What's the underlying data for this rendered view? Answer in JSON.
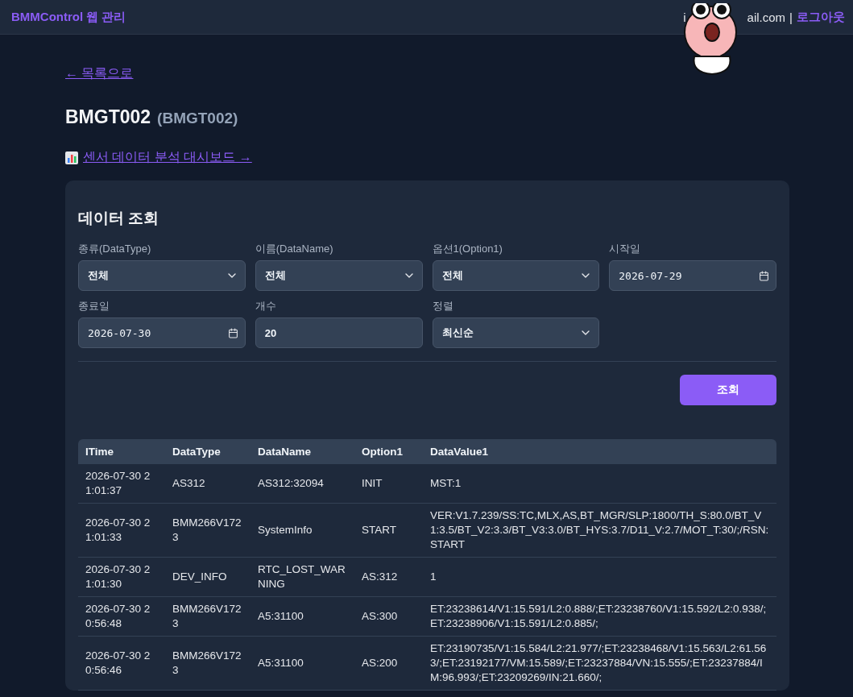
{
  "header": {
    "brand": "BMMControl 웹 관리",
    "email_start": "i",
    "email_end": "ail.com",
    "separator": "|",
    "logout": "로그아웃"
  },
  "back_link": "← 목록으로",
  "device": {
    "name": "BMGT002",
    "code": "(BMGT002)"
  },
  "dashboard_link": "센서 데이터 분석 대시보드 →",
  "query": {
    "title": "데이터 조회",
    "fields": [
      {
        "label": "종류(DataType)",
        "kind": "select",
        "value": "전체"
      },
      {
        "label": "이름(DataName)",
        "kind": "select",
        "value": "전체"
      },
      {
        "label": "옵션1(Option1)",
        "kind": "select",
        "value": "전체"
      },
      {
        "label": "시작일",
        "kind": "date",
        "value": "2026-07-29"
      },
      {
        "label": "종료일",
        "kind": "date",
        "value": "2026-07-30"
      },
      {
        "label": "개수",
        "kind": "number",
        "value": "20"
      },
      {
        "label": "정렬",
        "kind": "select",
        "value": "최신순"
      }
    ],
    "button": "조회"
  },
  "table": {
    "columns": [
      "ITime",
      "DataType",
      "DataName",
      "Option1",
      "DataValue1"
    ],
    "rows": [
      [
        "2026-07-30 21:01:37",
        "AS312",
        "AS312:32094",
        "INIT",
        "MST:1"
      ],
      [
        "2026-07-30 21:01:33",
        "BMM266V1723",
        "SystemInfo",
        "START",
        "VER:V1.7.239/SS:TC,MLX,AS,BT_MGR/SLP:1800/TH_S:80.0/BT_V1:3.5/BT_V2:3.3/BT_V3:3.0/BT_HYS:3.7/D11_V:2.7/MOT_T:30/;/RSN:START"
      ],
      [
        "2026-07-30 21:01:30",
        "DEV_INFO",
        "RTC_LOST_WARNING",
        "AS:312",
        "1"
      ],
      [
        "2026-07-30 20:56:48",
        "BMM266V1723",
        "A5:31100",
        "AS:300",
        "ET:23238614/V1:15.591/L2:0.888/;ET:23238760/V1:15.592/L2:0.938/;ET:23238906/V1:15.591/L2:0.885/;"
      ],
      [
        "2026-07-30 20:56:46",
        "BMM266V1723",
        "A5:31100",
        "AS:200",
        "ET:23190735/V1:15.584/L2:21.977/;ET:23238468/V1:15.563/L2:61.563/;ET:23192177/VM:15.589/;ET:23237884/VN:15.555/;ET:23237884/IM:96.993/;ET:23209269/IN:21.660/;"
      ]
    ]
  }
}
